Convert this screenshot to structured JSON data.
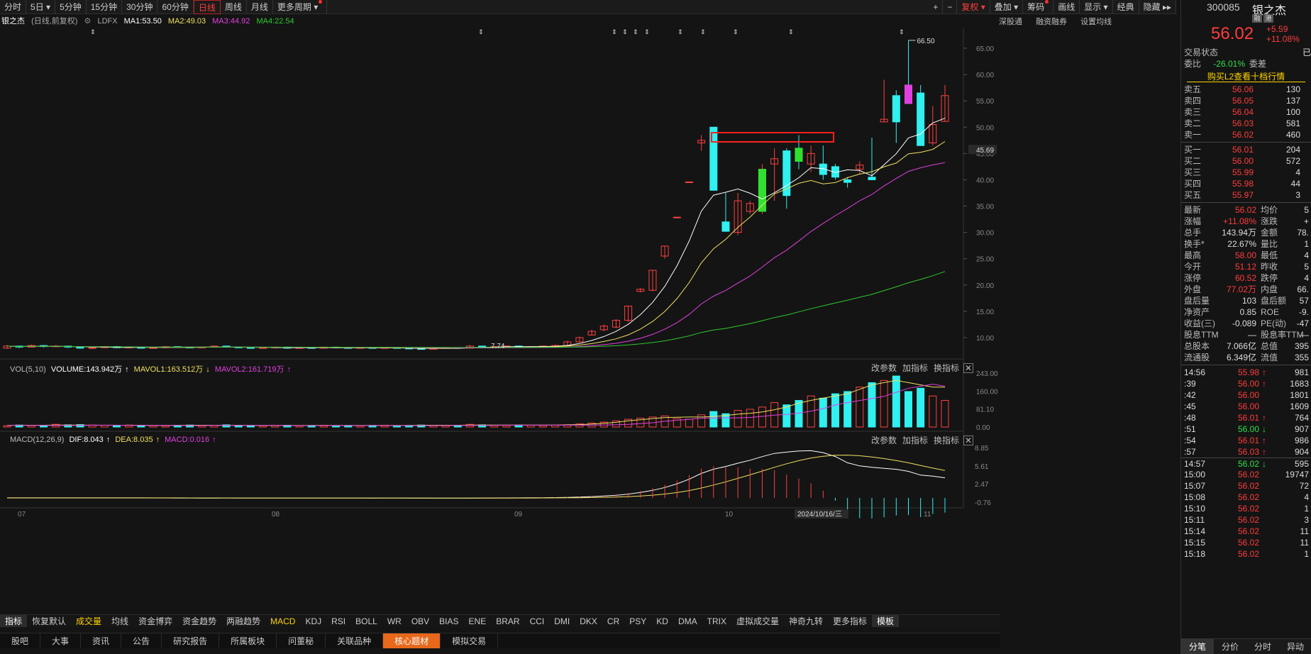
{
  "toolbar": {
    "tabs": [
      "分时",
      "5日",
      "5分钟",
      "15分钟",
      "30分钟",
      "60分钟",
      "日线",
      "周线",
      "月线",
      "更多周期"
    ],
    "active": "日线",
    "right": [
      "+",
      "−",
      "复权",
      "叠加",
      "筹码",
      "画线",
      "显示",
      "经典",
      "隐藏"
    ]
  },
  "info": {
    "name": "银之杰",
    "mode": "(日线,前复权)",
    "ldfx": "LDFX",
    "ma1": "MA1:53.50",
    "ma2": "MA2:49.03",
    "ma3": "MA3:44.92",
    "ma4": "MA4:22.54",
    "links": [
      "深股通",
      "融资融券",
      "设置均线"
    ]
  },
  "colors": {
    "ma1": "#ffffff",
    "ma2": "#f0e060",
    "ma3": "#e040e0",
    "ma4": "#2ec82e",
    "up": "#ff4040",
    "down": "#30f0f0"
  },
  "chart_data": {
    "type": "candlestick",
    "price_axis": [
      "65.00",
      "60.00",
      "55.00",
      "50.00",
      "45.00",
      "40.00",
      "35.00",
      "30.00",
      "25.00",
      "20.00",
      "15.00",
      "10.00"
    ],
    "current_price_label": "45.69",
    "high_label": "66.50",
    "low_label": "7.74",
    "date_labels": [
      "07",
      "08",
      "09",
      "10",
      "2024/10/16/三",
      "11"
    ],
    "candles": [
      {
        "o": 8.0,
        "c": 8.4,
        "h": 8.6,
        "l": 7.9
      },
      {
        "o": 8.4,
        "c": 8.2,
        "h": 8.5,
        "l": 8.0
      },
      {
        "o": 8.2,
        "c": 8.5,
        "h": 8.7,
        "l": 8.1
      },
      {
        "o": 8.5,
        "c": 8.3,
        "h": 8.6,
        "l": 8.1
      },
      {
        "o": 8.3,
        "c": 8.4,
        "h": 8.6,
        "l": 8.2
      },
      {
        "o": 8.4,
        "c": 8.2,
        "h": 8.5,
        "l": 8.0
      },
      {
        "o": 8.2,
        "c": 8.0,
        "h": 8.3,
        "l": 7.9
      },
      {
        "o": 8.0,
        "c": 8.1,
        "h": 8.2,
        "l": 7.8
      },
      {
        "o": 8.1,
        "c": 8.3,
        "h": 8.4,
        "l": 8.0
      },
      {
        "o": 8.3,
        "c": 8.1,
        "h": 8.4,
        "l": 8.0
      },
      {
        "o": 8.1,
        "c": 8.2,
        "h": 8.3,
        "l": 8.0
      },
      {
        "o": 8.2,
        "c": 8.0,
        "h": 8.3,
        "l": 7.9
      },
      {
        "o": 8.0,
        "c": 8.1,
        "h": 8.2,
        "l": 7.9
      },
      {
        "o": 8.1,
        "c": 8.3,
        "h": 8.4,
        "l": 8.0
      },
      {
        "o": 8.3,
        "c": 8.2,
        "h": 8.4,
        "l": 8.1
      },
      {
        "o": 8.2,
        "c": 8.1,
        "h": 8.3,
        "l": 8.0
      },
      {
        "o": 8.1,
        "c": 8.2,
        "h": 8.3,
        "l": 8.0
      },
      {
        "o": 8.2,
        "c": 8.4,
        "h": 8.5,
        "l": 8.1
      },
      {
        "o": 8.4,
        "c": 8.2,
        "h": 8.5,
        "l": 8.1
      },
      {
        "o": 8.2,
        "c": 8.1,
        "h": 8.3,
        "l": 8.0
      },
      {
        "o": 8.1,
        "c": 8.0,
        "h": 8.2,
        "l": 7.9
      },
      {
        "o": 8.0,
        "c": 8.1,
        "h": 8.2,
        "l": 7.9
      },
      {
        "o": 8.1,
        "c": 8.2,
        "h": 8.3,
        "l": 8.0
      },
      {
        "o": 8.2,
        "c": 8.0,
        "h": 8.3,
        "l": 7.9
      },
      {
        "o": 8.0,
        "c": 8.1,
        "h": 8.2,
        "l": 7.9
      },
      {
        "o": 8.1,
        "c": 8.0,
        "h": 8.2,
        "l": 7.9
      },
      {
        "o": 8.0,
        "c": 8.2,
        "h": 8.3,
        "l": 7.9
      },
      {
        "o": 8.2,
        "c": 8.1,
        "h": 8.3,
        "l": 8.0
      },
      {
        "o": 8.1,
        "c": 8.0,
        "h": 8.2,
        "l": 7.9
      },
      {
        "o": 8.0,
        "c": 8.1,
        "h": 8.2,
        "l": 7.9
      },
      {
        "o": 8.1,
        "c": 8.0,
        "h": 8.2,
        "l": 7.9
      },
      {
        "o": 8.0,
        "c": 8.1,
        "h": 8.2,
        "l": 7.9
      },
      {
        "o": 8.1,
        "c": 8.0,
        "h": 8.2,
        "l": 7.9
      },
      {
        "o": 8.0,
        "c": 7.9,
        "h": 8.1,
        "l": 7.8
      },
      {
        "o": 7.9,
        "c": 7.8,
        "h": 8.0,
        "l": 7.74
      },
      {
        "o": 7.8,
        "c": 8.0,
        "h": 8.1,
        "l": 7.8
      },
      {
        "o": 8.0,
        "c": 8.1,
        "h": 8.2,
        "l": 7.9
      },
      {
        "o": 8.1,
        "c": 8.0,
        "h": 8.2,
        "l": 7.9
      },
      {
        "o": 8.0,
        "c": 8.4,
        "h": 8.6,
        "l": 8.0
      },
      {
        "o": 8.4,
        "c": 8.2,
        "h": 8.5,
        "l": 8.1
      },
      {
        "o": 8.2,
        "c": 8.3,
        "h": 8.4,
        "l": 8.1
      },
      {
        "o": 8.3,
        "c": 8.4,
        "h": 8.5,
        "l": 8.2
      },
      {
        "o": 8.4,
        "c": 8.2,
        "h": 8.5,
        "l": 8.1
      },
      {
        "o": 8.2,
        "c": 8.3,
        "h": 8.4,
        "l": 8.1
      },
      {
        "o": 8.3,
        "c": 8.4,
        "h": 8.5,
        "l": 8.2
      },
      {
        "o": 8.4,
        "c": 8.5,
        "h": 8.7,
        "l": 8.3
      },
      {
        "o": 8.5,
        "c": 9.2,
        "h": 9.4,
        "l": 8.5
      },
      {
        "o": 9.2,
        "c": 10.0,
        "h": 10.2,
        "l": 9.1
      },
      {
        "o": 10.5,
        "c": 11.2,
        "h": 11.5,
        "l": 10.4
      },
      {
        "o": 11.5,
        "c": 12.2,
        "h": 12.5,
        "l": 11.2
      },
      {
        "o": 12.0,
        "c": 13.3,
        "h": 13.5,
        "l": 11.8
      },
      {
        "o": 13.3,
        "c": 16.0,
        "h": 16.0,
        "l": 13.0
      },
      {
        "o": 18.8,
        "c": 19.2,
        "h": 19.4,
        "l": 18.6
      },
      {
        "o": 19.0,
        "c": 22.8,
        "h": 22.8,
        "l": 18.8
      },
      {
        "o": 25.5,
        "c": 27.4,
        "h": 27.4,
        "l": 25.0
      },
      {
        "o": 32.8,
        "c": 32.9,
        "h": 32.9,
        "l": 32.7
      },
      {
        "o": 39.5,
        "c": 39.6,
        "h": 39.6,
        "l": 39.4
      },
      {
        "o": 47.0,
        "c": 47.5,
        "h": 48.5,
        "l": 45.5
      },
      {
        "o": 50.0,
        "c": 38.0,
        "h": 50.0,
        "l": 38.0
      },
      {
        "o": 32.0,
        "c": 30.2,
        "h": 37.5,
        "l": 30.2
      },
      {
        "o": 30.0,
        "c": 36.0,
        "h": 37.5,
        "l": 29.5
      },
      {
        "o": 34.0,
        "c": 35.5,
        "h": 36.0,
        "l": 33.5
      },
      {
        "o": 34.0,
        "c": 42.0,
        "h": 43.0,
        "l": 33.5
      },
      {
        "o": 43.0,
        "c": 44.0,
        "h": 46.0,
        "l": 36.0
      },
      {
        "o": 45.5,
        "c": 37.0,
        "h": 46.0,
        "l": 34.5
      },
      {
        "o": 46.0,
        "c": 43.5,
        "h": 48.5,
        "l": 42.0
      },
      {
        "o": 43.0,
        "c": 45.0,
        "h": 46.5,
        "l": 41.5
      },
      {
        "o": 43.0,
        "c": 41.0,
        "h": 46.5,
        "l": 40.0
      },
      {
        "o": 42.5,
        "c": 40.5,
        "h": 43.0,
        "l": 40.0
      },
      {
        "o": 40.0,
        "c": 39.5,
        "h": 40.5,
        "l": 38.5
      },
      {
        "o": 42.0,
        "c": 42.8,
        "h": 43.5,
        "l": 41.0
      },
      {
        "o": 40.5,
        "c": 40.0,
        "h": 48.0,
        "l": 40.0
      },
      {
        "o": 51.0,
        "c": 51.5,
        "h": 59.0,
        "l": 51.0
      },
      {
        "o": 56.0,
        "c": 51.0,
        "h": 57.0,
        "l": 47.0
      },
      {
        "o": 58.0,
        "c": 54.5,
        "h": 66.5,
        "l": 54.5
      },
      {
        "o": 56.5,
        "c": 46.5,
        "h": 58.0,
        "l": 46.5
      },
      {
        "o": 47.0,
        "c": 50.5,
        "h": 54.0,
        "l": 46.5
      },
      {
        "o": 51.1,
        "c": 56.0,
        "h": 58.0,
        "l": 51.0
      }
    ],
    "vol_axis": [
      "243.00",
      "160.00",
      "81.10",
      "0.00"
    ],
    "volumes": [
      6,
      9,
      7,
      8,
      12,
      10,
      11,
      9,
      8,
      7,
      9,
      8,
      7,
      6,
      8,
      9,
      7,
      8,
      10,
      8,
      7,
      6,
      7,
      8,
      6,
      7,
      8,
      6,
      7,
      6,
      7,
      8,
      6,
      7,
      9,
      8,
      7,
      6,
      12,
      10,
      8,
      7,
      9,
      8,
      7,
      8,
      10,
      14,
      18,
      22,
      28,
      35,
      40,
      45,
      50,
      38,
      35,
      55,
      70,
      60,
      75,
      80,
      90,
      110,
      100,
      120,
      140,
      130,
      150,
      160,
      180,
      200,
      210,
      230,
      160,
      175,
      140,
      120,
      200,
      240,
      180,
      230,
      240,
      220,
      150,
      160,
      200,
      170,
      130,
      95,
      115,
      230,
      210,
      100,
      150
    ],
    "vol_ma5": [
      8,
      8,
      8,
      8,
      9,
      9,
      9,
      8,
      8,
      8,
      8,
      8,
      7,
      7,
      8,
      8,
      8,
      8,
      8,
      8,
      7,
      7,
      7,
      7,
      7,
      7,
      7,
      7,
      7,
      7,
      7,
      7,
      7,
      7,
      8,
      8,
      8,
      8,
      9,
      9,
      9,
      9,
      9,
      9,
      9,
      9,
      10,
      11,
      13,
      17,
      21,
      28,
      33,
      38,
      43,
      44,
      45,
      45,
      47,
      52,
      58,
      62,
      68,
      78,
      90,
      108,
      120,
      130,
      140,
      150,
      170,
      190,
      200,
      210,
      200,
      190,
      180,
      180,
      185,
      195,
      200,
      205,
      210,
      205,
      200,
      195,
      185,
      175,
      165,
      160,
      155,
      150,
      160,
      170,
      160
    ],
    "macd": {
      "dif": "DIF:8.043",
      "dea": "DEA:8.035",
      "macd": "MACD:0.016",
      "axis": [
        "8.85",
        "5.61",
        "2.47",
        "-0.76"
      ]
    },
    "vol_info": {
      "title": "VOL(5,10)",
      "volume": "VOLUME:143.942万",
      "mavol1": "MAVOL1:163.512万",
      "mavol2": "MAVOL2:161.719万"
    },
    "macd_title": "MACD(12,26,9)"
  },
  "panel_ctl": [
    "改参数",
    "加指标",
    "换指标"
  ],
  "indicator_tabs": [
    "指标",
    "恢复默认",
    "成交量",
    "均线",
    "资金博弈",
    "资金趋势",
    "两融趋势",
    "MACD",
    "KDJ",
    "RSI",
    "BOLL",
    "WR",
    "OBV",
    "BIAS",
    "ENE",
    "BRAR",
    "CCI",
    "DMI",
    "DKX",
    "CR",
    "PSY",
    "KD",
    "DMA",
    "TRIX",
    "虚拟成交量",
    "神奇九转",
    "更多指标",
    "模板"
  ],
  "bottom_tabs": [
    "股吧",
    "大事",
    "资讯",
    "公告",
    "研究报告",
    "所属板块",
    "问董秘",
    "关联品种",
    "核心题材",
    "模拟交易"
  ],
  "bottom_active": "核心题材",
  "quote": {
    "code": "300085",
    "name": "银之杰",
    "badges": [
      "融",
      "港"
    ],
    "price": "56.02",
    "change": "+5.59",
    "pct": "+11.08%",
    "status_label": "交易状态",
    "status_val": "已",
    "wb_label": "委比",
    "wb_val": "-26.01%",
    "wc_label": "委差",
    "promo": "购买L2查看十档行情",
    "sells": [
      [
        "卖五",
        "56.06",
        "130"
      ],
      [
        "卖四",
        "56.05",
        "137"
      ],
      [
        "卖三",
        "56.04",
        "100"
      ],
      [
        "卖二",
        "56.03",
        "581"
      ],
      [
        "卖一",
        "56.02",
        "460"
      ]
    ],
    "buys": [
      [
        "买一",
        "56.01",
        "204"
      ],
      [
        "买二",
        "56.00",
        "572"
      ],
      [
        "买三",
        "55.99",
        "4"
      ],
      [
        "买四",
        "55.98",
        "44"
      ],
      [
        "买五",
        "55.97",
        "3"
      ]
    ],
    "stats": [
      [
        "最新",
        "56.02",
        "red",
        "均价",
        "5"
      ],
      [
        "涨幅",
        "+11.08%",
        "red",
        "涨跌",
        "+"
      ],
      [
        "总手",
        "143.94万",
        "wht",
        "金额",
        "78."
      ],
      [
        "换手*",
        "22.67%",
        "wht",
        "量比",
        "1"
      ],
      [
        "最高",
        "58.00",
        "red",
        "最低",
        "4"
      ],
      [
        "今开",
        "51.12",
        "red",
        "昨收",
        "5"
      ],
      [
        "涨停",
        "60.52",
        "red",
        "跌停",
        "4"
      ],
      [
        "外盘",
        "77.02万",
        "red",
        "内盘",
        "66."
      ],
      [
        "盘后量",
        "103",
        "wht",
        "盘后额",
        "57"
      ],
      [
        "净资产",
        "0.85",
        "wht",
        "ROE",
        "-9."
      ],
      [
        "收益(三)",
        "-0.089",
        "wht",
        "PE(动)",
        "-47"
      ],
      [
        "股息TTM",
        "—",
        "wht",
        "股息率TTM",
        "—"
      ],
      [
        "总股本",
        "7.066亿",
        "wht",
        "总值",
        "395"
      ],
      [
        "流通股",
        "6.349亿",
        "wht",
        "流值",
        "355"
      ]
    ],
    "ticks": [
      [
        "14:56",
        "55.98",
        "↑",
        "981"
      ],
      [
        ":39",
        "56.00",
        "↑",
        "1683"
      ],
      [
        ":42",
        "56.00",
        "",
        "1801"
      ],
      [
        ":45",
        "56.00",
        "",
        "1609"
      ],
      [
        ":48",
        "56.01",
        "↑",
        "764"
      ],
      [
        ":51",
        "56.00",
        "↓",
        "907"
      ],
      [
        ":54",
        "56.01",
        "↑",
        "986"
      ],
      [
        ":57",
        "56.03",
        "↑",
        "904"
      ],
      [
        "14:57",
        "56.02",
        "↓",
        "595"
      ],
      [
        "15:00",
        "56.02",
        "",
        "19747"
      ],
      [
        "15:07",
        "56.02",
        "",
        "72"
      ],
      [
        "15:08",
        "56.02",
        "",
        "4"
      ],
      [
        "15:10",
        "56.02",
        "",
        "1"
      ],
      [
        "15:11",
        "56.02",
        "",
        "3"
      ],
      [
        "15:14",
        "56.02",
        "",
        "11"
      ],
      [
        "15:15",
        "56.02",
        "",
        "11"
      ],
      [
        "15:18",
        "56.02",
        "",
        "1"
      ]
    ],
    "tabs": [
      "分笔",
      "分价",
      "分时",
      "异动"
    ]
  }
}
